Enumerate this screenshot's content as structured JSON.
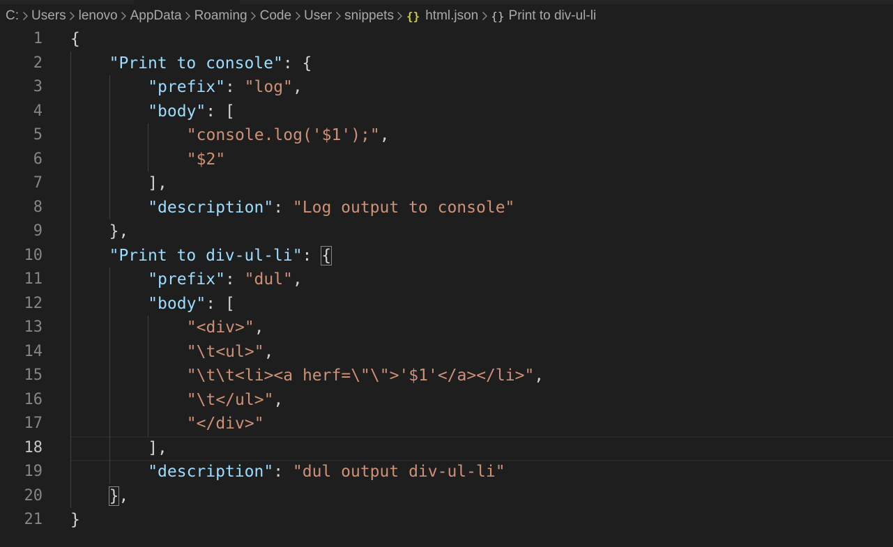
{
  "breadcrumb": {
    "items": [
      "C:",
      "Users",
      "lenovo",
      "AppData",
      "Roaming",
      "Code",
      "User",
      "snippets",
      "html.json",
      "Print to div-ul-li"
    ],
    "json_icon": "{}",
    "object_icon": "{}"
  },
  "editor": {
    "current_line": 18,
    "lines": [
      {
        "n": "1",
        "indent": 0,
        "tokens": [
          {
            "t": "{",
            "c": "punc"
          }
        ]
      },
      {
        "n": "2",
        "indent": 1,
        "tokens": [
          {
            "t": "\"Print to console\"",
            "c": "key"
          },
          {
            "t": ": {",
            "c": "punc"
          }
        ]
      },
      {
        "n": "3",
        "indent": 2,
        "tokens": [
          {
            "t": "\"prefix\"",
            "c": "key"
          },
          {
            "t": ": ",
            "c": "punc"
          },
          {
            "t": "\"log\"",
            "c": "str"
          },
          {
            "t": ",",
            "c": "punc"
          }
        ]
      },
      {
        "n": "4",
        "indent": 2,
        "tokens": [
          {
            "t": "\"body\"",
            "c": "key"
          },
          {
            "t": ": [",
            "c": "punc"
          }
        ]
      },
      {
        "n": "5",
        "indent": 3,
        "tokens": [
          {
            "t": "\"console.log('$1');\"",
            "c": "str"
          },
          {
            "t": ",",
            "c": "punc"
          }
        ]
      },
      {
        "n": "6",
        "indent": 3,
        "tokens": [
          {
            "t": "\"$2\"",
            "c": "str"
          }
        ]
      },
      {
        "n": "7",
        "indent": 2,
        "tokens": [
          {
            "t": "],",
            "c": "punc"
          }
        ]
      },
      {
        "n": "8",
        "indent": 2,
        "tokens": [
          {
            "t": "\"description\"",
            "c": "key"
          },
          {
            "t": ": ",
            "c": "punc"
          },
          {
            "t": "\"Log output to console\"",
            "c": "str"
          }
        ]
      },
      {
        "n": "9",
        "indent": 1,
        "tokens": [
          {
            "t": "},",
            "c": "punc"
          }
        ]
      },
      {
        "n": "10",
        "indent": 1,
        "tokens": [
          {
            "t": "\"Print to div-ul-li\"",
            "c": "key"
          },
          {
            "t": ": ",
            "c": "punc"
          },
          {
            "t": "{",
            "c": "punc",
            "match": true
          }
        ]
      },
      {
        "n": "11",
        "indent": 2,
        "tokens": [
          {
            "t": "\"prefix\"",
            "c": "key"
          },
          {
            "t": ": ",
            "c": "punc"
          },
          {
            "t": "\"dul\"",
            "c": "str"
          },
          {
            "t": ",",
            "c": "punc"
          }
        ]
      },
      {
        "n": "12",
        "indent": 2,
        "tokens": [
          {
            "t": "\"body\"",
            "c": "key"
          },
          {
            "t": ": [",
            "c": "punc"
          }
        ]
      },
      {
        "n": "13",
        "indent": 3,
        "tokens": [
          {
            "t": "\"<div>\"",
            "c": "str"
          },
          {
            "t": ",",
            "c": "punc"
          }
        ]
      },
      {
        "n": "14",
        "indent": 3,
        "tokens": [
          {
            "t": "\"\\t<ul>\"",
            "c": "str"
          },
          {
            "t": ",",
            "c": "punc"
          }
        ]
      },
      {
        "n": "15",
        "indent": 3,
        "tokens": [
          {
            "t": "\"\\t\\t<li><a herf=\\\"\\\">'$1'</a></li>\"",
            "c": "str"
          },
          {
            "t": ",",
            "c": "punc"
          }
        ]
      },
      {
        "n": "16",
        "indent": 3,
        "tokens": [
          {
            "t": "\"\\t</ul>\"",
            "c": "str"
          },
          {
            "t": ",",
            "c": "punc"
          }
        ]
      },
      {
        "n": "17",
        "indent": 3,
        "tokens": [
          {
            "t": "\"</div>\"",
            "c": "str"
          }
        ]
      },
      {
        "n": "18",
        "indent": 2,
        "tokens": [
          {
            "t": "],",
            "c": "punc"
          }
        ]
      },
      {
        "n": "19",
        "indent": 2,
        "tokens": [
          {
            "t": "\"description\"",
            "c": "key"
          },
          {
            "t": ": ",
            "c": "punc"
          },
          {
            "t": "\"dul output div-ul-li\"",
            "c": "str"
          }
        ]
      },
      {
        "n": "20",
        "indent": 1,
        "tokens": [
          {
            "t": "}",
            "c": "punc",
            "match": true
          },
          {
            "t": ",",
            "c": "punc"
          }
        ]
      },
      {
        "n": "21",
        "indent": 0,
        "tokens": [
          {
            "t": "}",
            "c": "punc"
          }
        ]
      }
    ]
  },
  "colors": {
    "background": "#1e1e1e",
    "key": "#9cdcfe",
    "string": "#ce9178",
    "punctuation": "#d4d4d4",
    "line_number": "#858585",
    "json_icon": "#cbcb41"
  }
}
